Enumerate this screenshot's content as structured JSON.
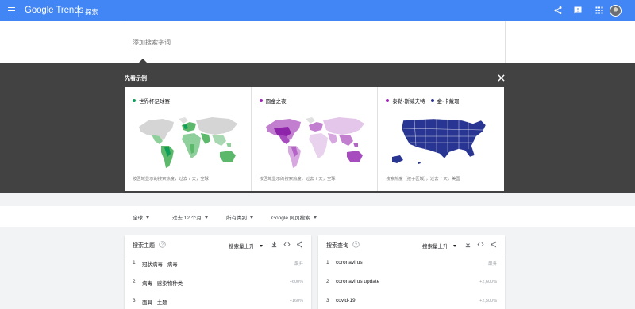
{
  "app": {
    "logo": "Google Trends",
    "page_name": "探索"
  },
  "search": {
    "placeholder": "添加搜索字词"
  },
  "examples": {
    "title": "先看示例",
    "cards": [
      {
        "legend": [
          {
            "label": "世界杯足球赛",
            "color": "#0f9d58"
          }
        ],
        "caption": "按区域显示的搜索热度，过去 7 天，全球"
      },
      {
        "legend": [
          {
            "label": "圆金之夜",
            "color": "#9c27b0"
          }
        ],
        "caption": "按区域显示的搜索热度，过去 7 天，全球"
      },
      {
        "legend": [
          {
            "label": "泰勒·斯威夫特",
            "color": "#9c27b0"
          },
          {
            "label": "金·卡戴珊",
            "color": "#283593"
          }
        ],
        "caption": "搜索热度（按子区域），过去 7 天，美国"
      }
    ]
  },
  "filters": {
    "region": "全球",
    "time": "过去 12 个月",
    "category": "所有类别",
    "property": "Google 网页搜索"
  },
  "widgets": {
    "topics": {
      "title": "搜索主题",
      "sort": "搜索量上升",
      "rows": [
        {
          "rank": "1",
          "label": "冠状病毒 - 病毒",
          "value": "飙升"
        },
        {
          "rank": "2",
          "label": "病毒 - 感染物种类",
          "value": "+600%"
        },
        {
          "rank": "3",
          "label": "面具 - 主题",
          "value": "+160%"
        }
      ]
    },
    "queries": {
      "title": "搜索查询",
      "sort": "搜索量上升",
      "rows": [
        {
          "rank": "1",
          "label": "coronavirus",
          "value": "飙升"
        },
        {
          "rank": "2",
          "label": "coronavirus update",
          "value": "+2,600%"
        },
        {
          "rank": "3",
          "label": "covid-19",
          "value": "+2,500%"
        }
      ]
    }
  },
  "colors": {
    "accent": "#4285f4",
    "panel": "#424242",
    "green": "#0f9d58",
    "purple": "#9c27b0",
    "navy": "#283593"
  },
  "icons": {
    "menu": "menu-icon",
    "share": "share-icon",
    "feedback": "feedback-icon",
    "apps": "apps-icon",
    "close": "close-icon",
    "help": "help-icon",
    "download": "download-icon",
    "embed": "embed-icon"
  }
}
